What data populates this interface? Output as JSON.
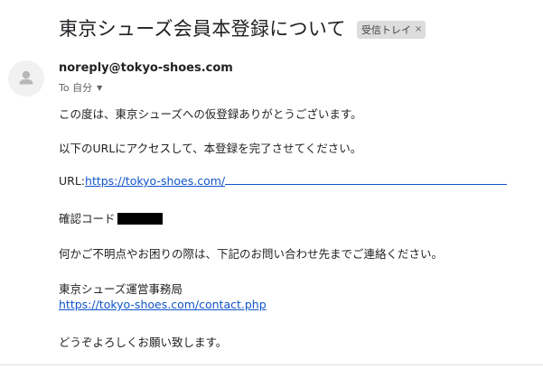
{
  "email": {
    "subject": "東京シューズ会員本登録について",
    "label": "受信トレイ",
    "label_remove": "×",
    "sender": "noreply@tokyo-shoes.com",
    "to": "To 自分",
    "avatar_icon": "person-icon",
    "body": {
      "greeting": "この度は、東京シューズへの仮登録ありがとうございます。",
      "instruction": "以下のURLにアクセスして、本登録を完了させてください。",
      "url_prefix": "URL:",
      "url_link": "https://tokyo-shoes.com/",
      "code_label": "確認コード",
      "inquiry": "何かご不明点やお困りの際は、下記のお問い合わせ先までご連絡ください。",
      "office": "東京シューズ運営事務局",
      "contact_link": "https://tokyo-shoes.com/contact.php",
      "closing": "どうぞよろしくお願い致します。"
    }
  },
  "colors": {
    "link": "#1155cc",
    "label_bg": "#dddddd",
    "text": "#222222"
  }
}
